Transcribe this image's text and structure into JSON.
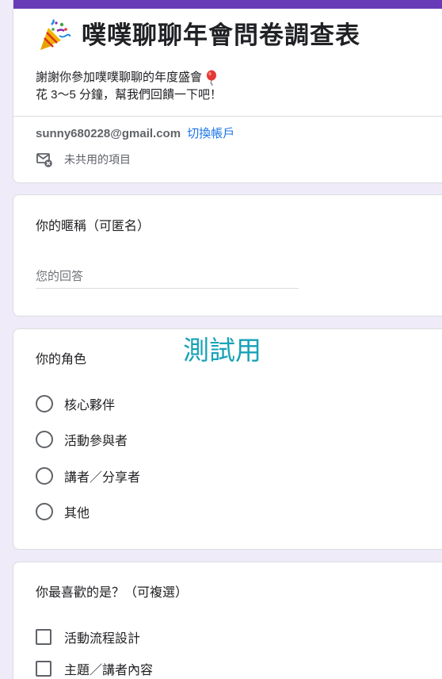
{
  "header": {
    "title": "噗噗聊聊年會問卷調查表",
    "desc_line1": "謝謝你參加噗噗聊聊的年度盛會",
    "desc_line2": "花 3～5 分鐘，幫我們回饋一下吧！",
    "email": "sunny680228@gmail.com",
    "switch_account": "切換帳戶",
    "unshared": "未共用的項目",
    "accent_color": "#673ab7",
    "icons": [
      "party-popper-icon",
      "balloon-icon",
      "mail-icon"
    ]
  },
  "questions": {
    "nickname": {
      "title": "你的暱稱（可匿名）",
      "placeholder": "您的回答"
    },
    "role": {
      "title": "你的角色",
      "options": [
        "核心夥伴",
        "活動參與者",
        "講者／分享者",
        "其他"
      ]
    },
    "favorite": {
      "title": "你最喜歡的是？（可複選）",
      "options": [
        "活動流程設計",
        "主題／講者內容"
      ]
    }
  },
  "watermark": "測試用"
}
